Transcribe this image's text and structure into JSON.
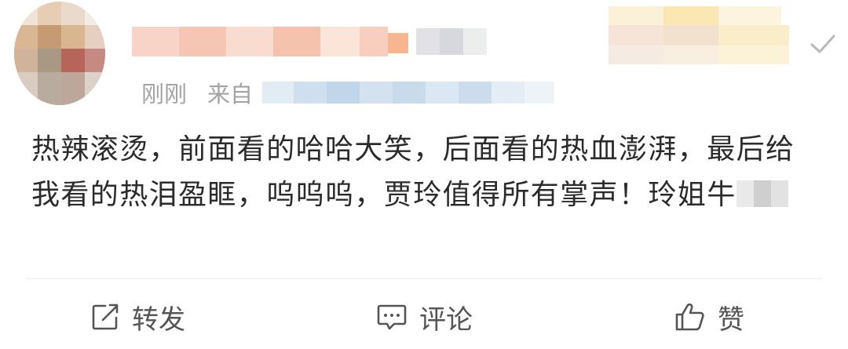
{
  "post": {
    "time": "刚刚",
    "source_prefix": "来自",
    "text": "热辣滚烫，前面看的哈哈大笑，后面看的热血澎湃，最后给我看的热泪盈眶，呜呜呜，贾玲值得所有掌声！玲姐牛"
  },
  "actions": {
    "repost_label": "转发",
    "comment_label": "评论",
    "like_label": "赞"
  },
  "colors": {
    "text": "#2b2b2b",
    "meta": "#a3a3a3",
    "action": "#555555",
    "divider": "#ebebeb"
  },
  "icons": {
    "repost": "share-edit-icon",
    "comment": "comment-bubble-icon",
    "like": "thumbs-up-icon",
    "follow": "checkmark-icon"
  }
}
